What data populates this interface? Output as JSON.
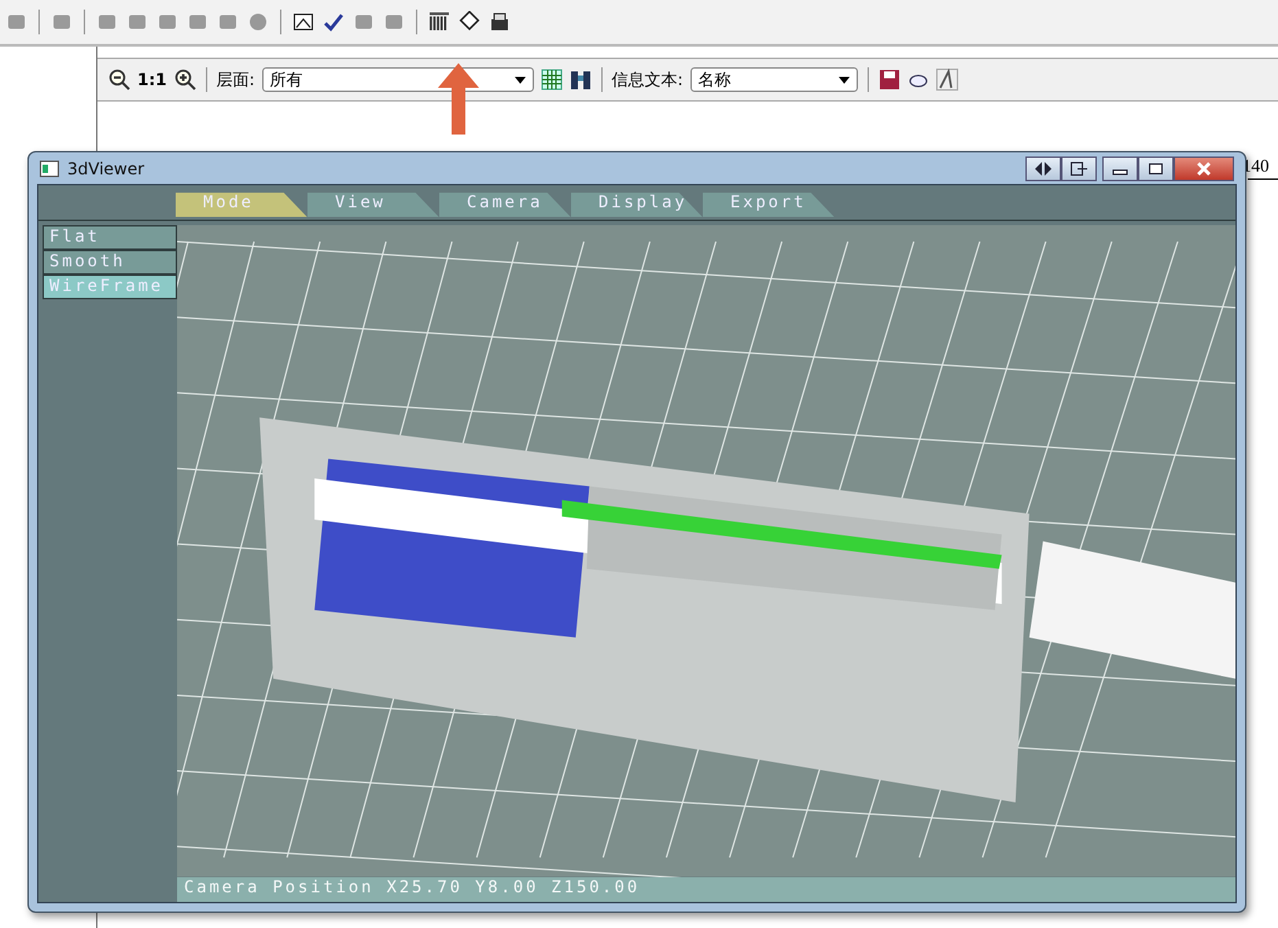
{
  "view_toolbar": {
    "zoom_label": "1:1",
    "layer_label": "层面:",
    "layer_value": "所有",
    "info_label": "信息文本:",
    "info_value": "名称"
  },
  "ruler": {
    "label": "140"
  },
  "viewer": {
    "title": "3dViewer",
    "tabs": [
      {
        "label": "Mode",
        "selected": true
      },
      {
        "label": "View",
        "selected": false
      },
      {
        "label": "Camera",
        "selected": false
      },
      {
        "label": "Display",
        "selected": false
      },
      {
        "label": "Export",
        "selected": false
      }
    ],
    "modes": [
      {
        "label": "Flat",
        "selected": false
      },
      {
        "label": "Smooth",
        "selected": false
      },
      {
        "label": "WireFrame",
        "selected": true
      }
    ],
    "status": "Camera Position X25.70 Y8.00 Z150.00"
  }
}
